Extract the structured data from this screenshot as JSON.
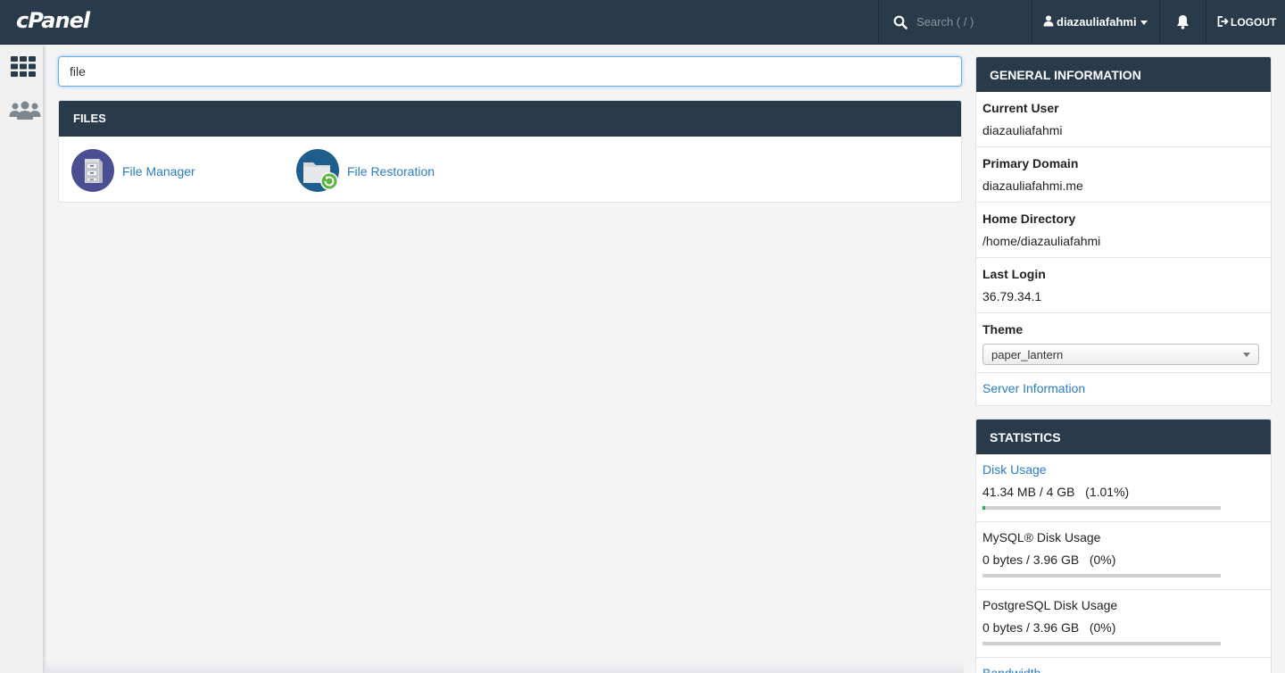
{
  "header": {
    "logo": "cPanel",
    "search_placeholder": "Search ( / )",
    "username": "diazauliafahmi",
    "logout_label": "LOGOUT"
  },
  "sidebar": {
    "items": [
      {
        "name": "home",
        "icon": "grid-icon"
      },
      {
        "name": "users",
        "icon": "users-icon"
      }
    ]
  },
  "main": {
    "search_value": "file",
    "files_panel": {
      "title": "FILES",
      "apps": [
        {
          "label": "File Manager",
          "icon": "file-cabinet-icon"
        },
        {
          "label": "File Restoration",
          "icon": "folder-restore-icon"
        }
      ]
    }
  },
  "general_info": {
    "title": "GENERAL INFORMATION",
    "current_user_label": "Current User",
    "current_user": "diazauliafahmi",
    "primary_domain_label": "Primary Domain",
    "primary_domain": "diazauliafahmi.me",
    "home_directory_label": "Home Directory",
    "home_directory": "/home/diazauliafahmi",
    "last_login_label": "Last Login",
    "last_login": "36.79.34.1",
    "theme_label": "Theme",
    "theme_value": "paper_lantern",
    "server_info_link": "Server Information"
  },
  "statistics": {
    "title": "STATISTICS",
    "items": [
      {
        "label": "Disk Usage",
        "value": "41.34 MB / 4 GB",
        "percent": "(1.01%)",
        "fraction": 0.0101,
        "is_link": true
      },
      {
        "label": "MySQL® Disk Usage",
        "value": "0 bytes / 3.96 GB",
        "percent": "(0%)",
        "fraction": 0,
        "is_link": false
      },
      {
        "label": "PostgreSQL Disk Usage",
        "value": "0 bytes / 3.96 GB",
        "percent": "(0%)",
        "fraction": 0,
        "is_link": false
      }
    ],
    "partial_label": "Bandwidth"
  },
  "colors": {
    "navbar": "#293a4a",
    "link": "#2a7cc7",
    "progress_fill": "#2bae4b"
  }
}
